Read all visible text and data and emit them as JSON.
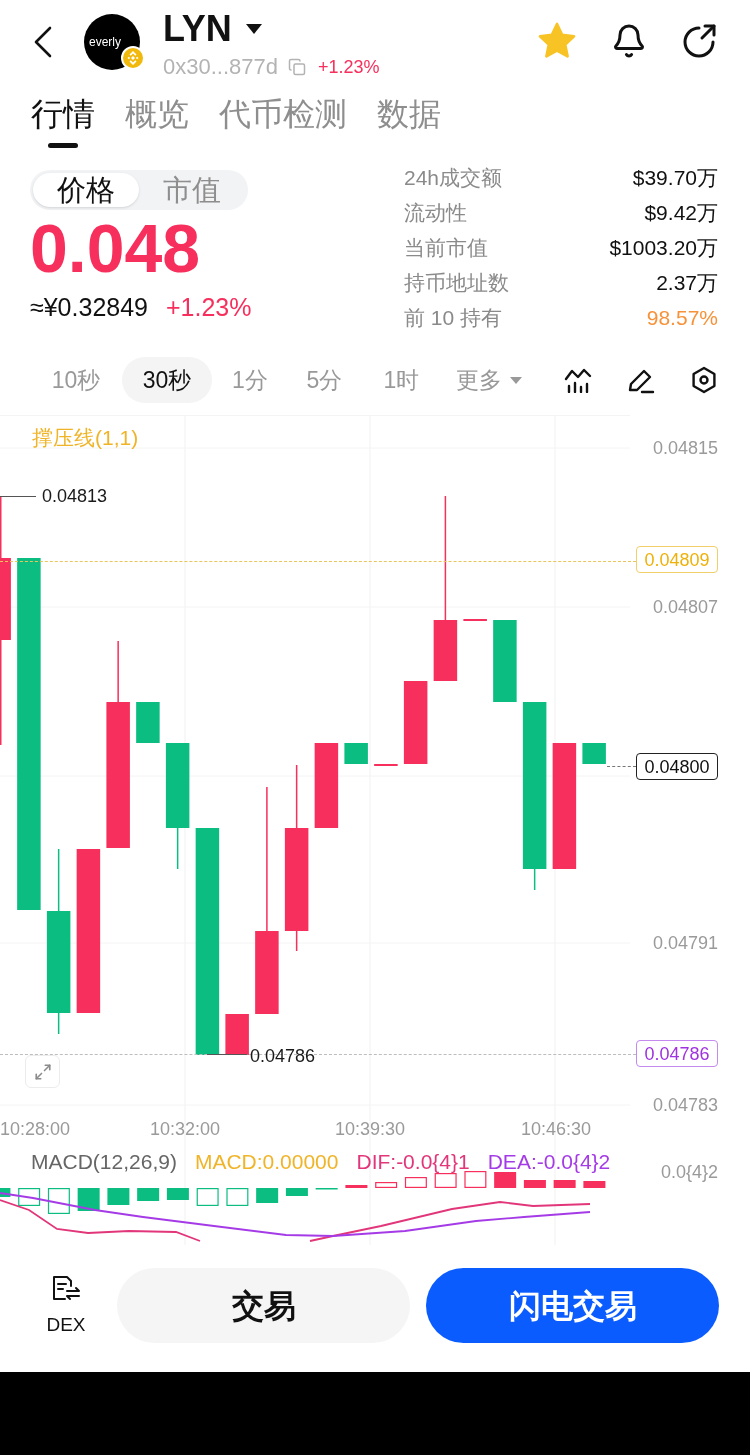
{
  "header": {
    "symbol": "LYN",
    "logo_text": "everly",
    "address": "0x30...877d",
    "change": "+1.23%",
    "favorited": true
  },
  "tabs": [
    {
      "label": "行情",
      "selected": true
    },
    {
      "label": "概览",
      "selected": false
    },
    {
      "label": "代币检测",
      "selected": false
    },
    {
      "label": "数据",
      "selected": false
    }
  ],
  "price_panel": {
    "modes": [
      {
        "label": "价格",
        "selected": true
      },
      {
        "label": "市值",
        "selected": false
      }
    ],
    "price": "0.048",
    "fiat_price": "≈¥0.32849",
    "change": "+1.23%"
  },
  "stats": [
    {
      "label": "24h成交额",
      "value": "$39.70万",
      "highlighted": false
    },
    {
      "label": "流动性",
      "value": "$9.42万",
      "highlighted": false
    },
    {
      "label": "当前市值",
      "value": "$1003.20万",
      "highlighted": false
    },
    {
      "label": "持币地址数",
      "value": "2.37万",
      "highlighted": false
    },
    {
      "label": "前 10 持有",
      "value": "98.57%",
      "highlighted": true
    }
  ],
  "intervals": [
    {
      "label": "10秒",
      "selected": false,
      "kind": "interval"
    },
    {
      "label": "30秒",
      "selected": true,
      "kind": "interval"
    },
    {
      "label": "1分",
      "selected": false,
      "kind": "interval"
    },
    {
      "label": "5分",
      "selected": false,
      "kind": "interval"
    },
    {
      "label": "1时",
      "selected": false,
      "kind": "interval"
    },
    {
      "label": "更多",
      "selected": false,
      "kind": "menu"
    }
  ],
  "chart": {
    "indicator": "撑压线(1,1)",
    "y_axis": [
      "0.04815",
      "0.04807",
      "0.04791",
      "0.04783"
    ],
    "high_label": "0.04813",
    "low_label": "0.04786",
    "resistance_tag": "0.04809",
    "current_price_tag": "0.04800",
    "support_tag": "0.04786",
    "x_axis": [
      "10:28:00",
      "10:32:00",
      "10:39:30",
      "10:46:30"
    ]
  },
  "macd": {
    "title": "MACD(12,26,9)",
    "macd": "MACD:0.00000",
    "dif": "DIF:-0.0{4}1",
    "dea": "DEA:-0.0{4}2",
    "axis_label": "0.0{4}2"
  },
  "bottom_bar": {
    "dex_label": "DEX",
    "buttons": [
      {
        "label": "交易",
        "kind": "secondary"
      },
      {
        "label": "闪电交易",
        "kind": "primary"
      }
    ]
  }
}
